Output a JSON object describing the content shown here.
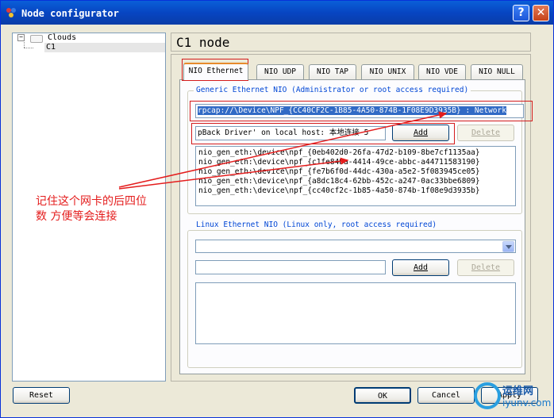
{
  "window": {
    "title": "Node configurator",
    "help_label": "?",
    "close_label": "✕"
  },
  "tree": {
    "root": "Clouds",
    "child": "C1",
    "expander": "−"
  },
  "panel": {
    "title": "C1 node"
  },
  "tabs": [
    "NIO Ethernet",
    "NIO UDP",
    "NIO TAP",
    "NIO UNIX",
    "NIO VDE",
    "NIO NULL"
  ],
  "generic": {
    "label": "Generic Ethernet NIO (Administrator or root access required)",
    "adapter_value": "rpcap://\\Device\\NPF_{CC40CF2C-1B85-4A50-874B-1F08E9D3935B} : Network",
    "host_value": "pBack Driver' on local host: 本地连接 5",
    "add_label": "Add",
    "delete_label": "Delete",
    "items": [
      "nio_gen_eth:\\device\\npf_{0eb402d0-26fa-47d2-b109-8be7cf1135aa}",
      "nio_gen_eth:\\device\\npf_{c1fe848a-4414-49ce-abbc-a44711583190}",
      "nio_gen_eth:\\device\\npf_{fe7b6f0d-44dc-430a-a5e2-5f083945ce05}",
      "nio_gen_eth:\\device\\npf_{a8dc18c4-62bb-452c-a247-0ac33bbe6809}",
      "nio_gen_eth:\\device\\npf_{cc40cf2c-1b85-4a50-874b-1f08e9d3935b}"
    ]
  },
  "linux": {
    "label": "Linux Ethernet NIO (Linux only, root access required)",
    "combo_value": "",
    "input_value": "",
    "add_label": "Add",
    "delete_label": "Delete"
  },
  "annotation": {
    "line1": "记住这个网卡的后四位",
    "line2": "数 方便等会连接"
  },
  "footer": {
    "reset_label": "Reset",
    "ok_label": "OK",
    "cancel_label": "Cancel",
    "apply_label": "Apply"
  },
  "watermark": {
    "text": "运维网",
    "url": "iyunv.com"
  },
  "colors": {
    "accent": "#0046d5",
    "annotation": "#e41d1d",
    "titlebar": "#0745c2"
  }
}
